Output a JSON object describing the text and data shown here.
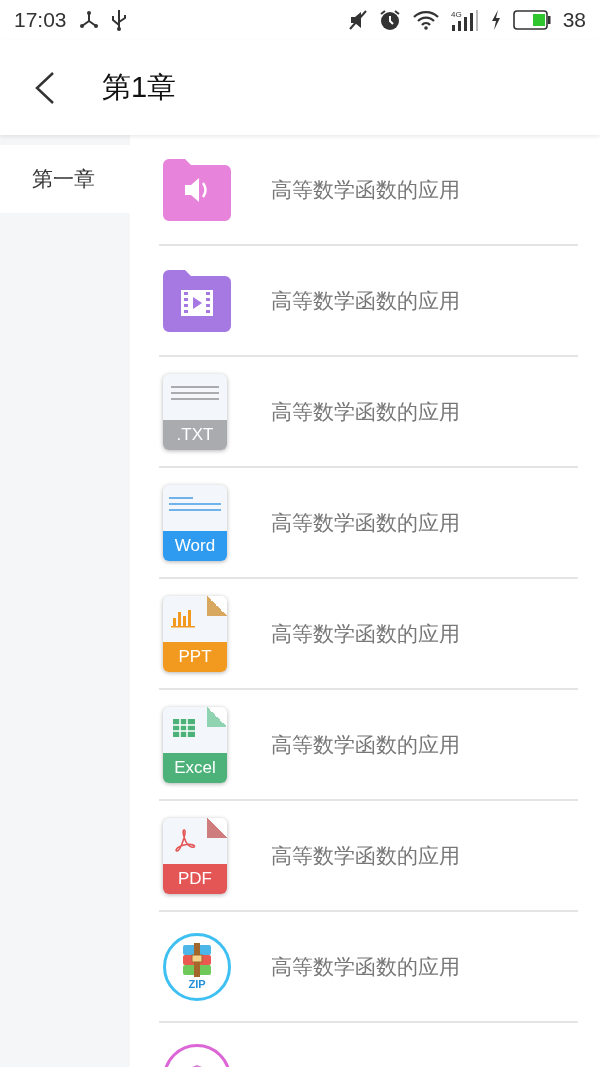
{
  "status_bar": {
    "time": "17:03",
    "battery": "38",
    "network": "4G"
  },
  "header": {
    "title": "第1章"
  },
  "sidebar": {
    "items": [
      {
        "label": "第一章",
        "selected": true
      }
    ]
  },
  "files": [
    {
      "kind": "audio",
      "title": "高等数学函数的应用"
    },
    {
      "kind": "video",
      "title": "高等数学函数的应用"
    },
    {
      "kind": "txt",
      "badge": ".TXT",
      "title": "高等数学函数的应用"
    },
    {
      "kind": "word",
      "badge": "Word",
      "title": "高等数学函数的应用"
    },
    {
      "kind": "ppt",
      "badge": "PPT",
      "title": "高等数学函数的应用"
    },
    {
      "kind": "excel",
      "badge": "Excel",
      "title": "高等数学函数的应用"
    },
    {
      "kind": "pdf",
      "badge": "PDF",
      "title": "高等数学函数的应用"
    },
    {
      "kind": "zip",
      "badge": "ZIP",
      "title": "高等数学函数的应用"
    },
    {
      "kind": "package"
    }
  ]
}
